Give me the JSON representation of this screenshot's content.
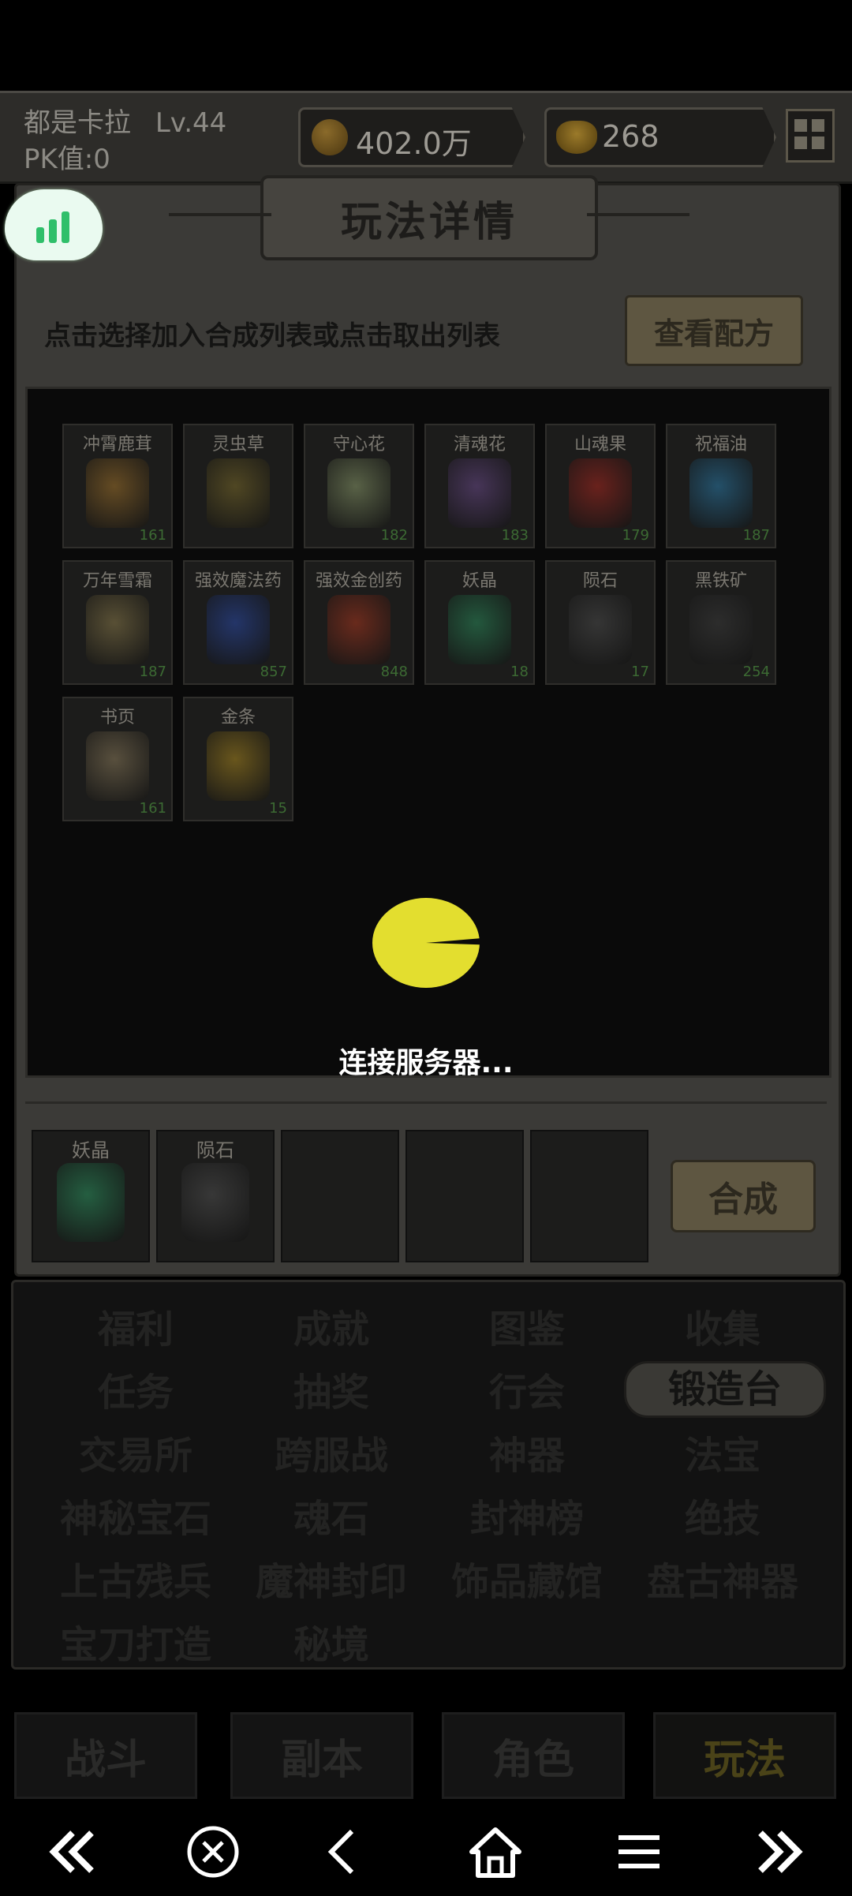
{
  "header": {
    "player_name": "都是卡拉",
    "level": "Lv.44",
    "pk_label": "PK值:0",
    "coins": "402.0万",
    "ingots": "268"
  },
  "panel": {
    "title": "玩法详情",
    "hint": "点击选择加入合成列表或点击取出列表",
    "recipe_button": "查看配方"
  },
  "inventory": [
    {
      "name": "冲霄鹿茸",
      "count": "161",
      "color": "#a0722a"
    },
    {
      "name": "灵虫草",
      "count": "",
      "color": "#7a6a2a"
    },
    {
      "name": "守心花",
      "count": "182",
      "color": "#8a9a6a"
    },
    {
      "name": "清魂花",
      "count": "183",
      "color": "#6a4a8a"
    },
    {
      "name": "山魂果",
      "count": "179",
      "color": "#a8261e"
    },
    {
      "name": "祝福油",
      "count": "187",
      "color": "#2a7aa8"
    },
    {
      "name": "万年雪霜",
      "count": "187",
      "color": "#8a7a4a"
    },
    {
      "name": "强效魔法药",
      "count": "857",
      "color": "#2a4aa8"
    },
    {
      "name": "强效金创药",
      "count": "848",
      "color": "#a8361e"
    },
    {
      "name": "妖晶",
      "count": "18",
      "color": "#2a8a5a"
    },
    {
      "name": "陨石",
      "count": "17",
      "color": "#4a4a4a"
    },
    {
      "name": "黑铁矿",
      "count": "254",
      "color": "#3a3a3a"
    },
    {
      "name": "书页",
      "count": "161",
      "color": "#8a7a5a"
    },
    {
      "name": "金条",
      "count": "15",
      "color": "#a8861e"
    }
  ],
  "loading_text": "连接服务器...",
  "craft": {
    "slots": [
      {
        "name": "妖晶",
        "color": "#2a8a5a"
      },
      {
        "name": "陨石",
        "color": "#4a4a4a"
      },
      {
        "name": "",
        "color": ""
      },
      {
        "name": "",
        "color": ""
      },
      {
        "name": "",
        "color": ""
      }
    ],
    "button": "合成"
  },
  "menu": [
    [
      "福利",
      "成就",
      "图鉴",
      "收集"
    ],
    [
      "任务",
      "抽奖",
      "行会",
      "锻造台"
    ],
    [
      "交易所",
      "跨服战",
      "神器",
      "法宝"
    ],
    [
      "神秘宝石",
      "魂石",
      "封神榜",
      "绝技"
    ],
    [
      "上古残兵",
      "魔神封印",
      "饰品藏馆",
      "盘古神器"
    ],
    [
      "宝刀打造",
      "秘境"
    ]
  ],
  "menu_active": "锻造台",
  "tabs": [
    "战斗",
    "副本",
    "角色",
    "玩法"
  ],
  "tab_active": "玩法"
}
